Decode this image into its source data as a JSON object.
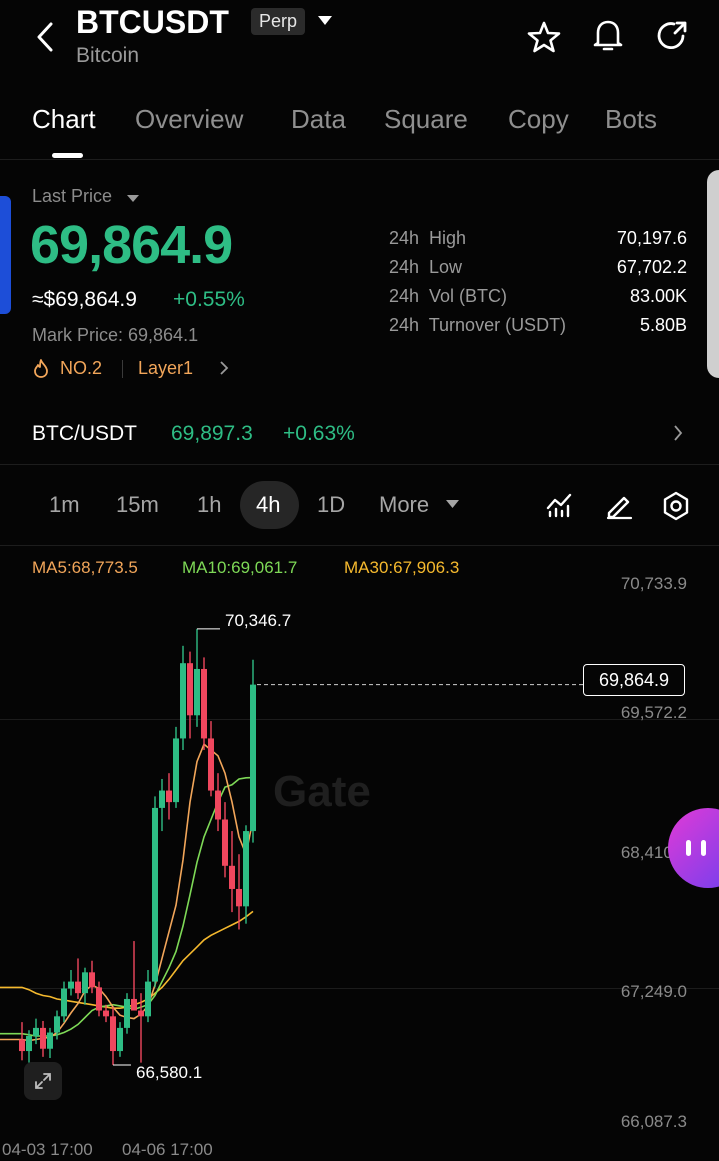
{
  "header": {
    "symbol": "BTCUSDT",
    "badge": "Perp",
    "subtitle": "Bitcoin",
    "icons": [
      "back-icon",
      "star-icon",
      "bell-icon",
      "share-icon"
    ]
  },
  "tabs": [
    "Chart",
    "Overview",
    "Data",
    "Square",
    "Copy",
    "Bots"
  ],
  "active_tab": "Chart",
  "price": {
    "label": "Last Price",
    "last": "69,864.9",
    "usd": "≈$69,864.9",
    "change": "+0.55%",
    "mark": "Mark Price: 69,864.1",
    "rank": "NO.2",
    "tag": "Layer1"
  },
  "stats": [
    {
      "label": "24h  High",
      "value": "70,197.6"
    },
    {
      "label": "24h  Low",
      "value": "67,702.2"
    },
    {
      "label": "24h  Vol (BTC)",
      "value": "83.00K"
    },
    {
      "label": "24h  Turnover (USDT)",
      "value": "5.80B"
    }
  ],
  "spot": {
    "pair": "BTC/USDT",
    "price": "69,897.3",
    "change": "+0.63%"
  },
  "timeframes": [
    "1m",
    "15m",
    "1h",
    "4h",
    "1D"
  ],
  "active_timeframe": "4h",
  "more_label": "More",
  "ma": {
    "ma5": "MA5:68,773.5",
    "ma10": "MA10:69,061.7",
    "ma30": "MA30:67,906.3"
  },
  "colors": {
    "up": "#2ebd85",
    "down": "#f0475e",
    "ma5": "#f2a65a",
    "ma10": "#7ed957",
    "ma30": "#f5b92e"
  },
  "chart_data": {
    "type": "candlestick",
    "y_ticks": [
      "70,733.9",
      "69,572.2",
      "68,410.6",
      "67,249.0",
      "66,087.3"
    ],
    "x_ticks": [
      "04-03 17:00",
      "04-06 17:00"
    ],
    "high_label": "70,346.7",
    "low_label": "66,580.1",
    "current_label": "69,864.9",
    "candles": [
      {
        "o": 66800,
        "h": 66950,
        "l": 66620,
        "c": 66700
      },
      {
        "o": 66700,
        "h": 66880,
        "l": 66600,
        "c": 66830
      },
      {
        "o": 66830,
        "h": 66980,
        "l": 66760,
        "c": 66900
      },
      {
        "o": 66900,
        "h": 66960,
        "l": 66650,
        "c": 66720
      },
      {
        "o": 66720,
        "h": 66900,
        "l": 66640,
        "c": 66860
      },
      {
        "o": 66860,
        "h": 67050,
        "l": 66800,
        "c": 67000
      },
      {
        "o": 67000,
        "h": 67300,
        "l": 66950,
        "c": 67240
      },
      {
        "o": 67240,
        "h": 67400,
        "l": 67180,
        "c": 67300
      },
      {
        "o": 67300,
        "h": 67500,
        "l": 67150,
        "c": 67200
      },
      {
        "o": 67200,
        "h": 67420,
        "l": 67100,
        "c": 67380
      },
      {
        "o": 67380,
        "h": 67480,
        "l": 67200,
        "c": 67250
      },
      {
        "o": 67250,
        "h": 67300,
        "l": 67000,
        "c": 67050
      },
      {
        "o": 67050,
        "h": 67100,
        "l": 66950,
        "c": 67000
      },
      {
        "o": 67000,
        "h": 67080,
        "l": 66580,
        "c": 66700
      },
      {
        "o": 66700,
        "h": 66950,
        "l": 66650,
        "c": 66900
      },
      {
        "o": 66900,
        "h": 67200,
        "l": 66850,
        "c": 67150
      },
      {
        "o": 67150,
        "h": 67650,
        "l": 67100,
        "c": 67050
      },
      {
        "o": 67050,
        "h": 67200,
        "l": 66600,
        "c": 67000
      },
      {
        "o": 67000,
        "h": 67400,
        "l": 66950,
        "c": 67300
      },
      {
        "o": 67300,
        "h": 68900,
        "l": 67250,
        "c": 68800
      },
      {
        "o": 68800,
        "h": 69050,
        "l": 68600,
        "c": 68950
      },
      {
        "o": 68950,
        "h": 69100,
        "l": 68700,
        "c": 68850
      },
      {
        "o": 68850,
        "h": 69500,
        "l": 68800,
        "c": 69400
      },
      {
        "o": 69400,
        "h": 70200,
        "l": 69300,
        "c": 70050
      },
      {
        "o": 70050,
        "h": 70150,
        "l": 69400,
        "c": 69600
      },
      {
        "o": 69600,
        "h": 70346.7,
        "l": 69500,
        "c": 70000
      },
      {
        "o": 70000,
        "h": 70100,
        "l": 69300,
        "c": 69400
      },
      {
        "o": 69400,
        "h": 69550,
        "l": 68900,
        "c": 68950
      },
      {
        "o": 68950,
        "h": 69100,
        "l": 68600,
        "c": 68700
      },
      {
        "o": 68700,
        "h": 68850,
        "l": 68200,
        "c": 68300
      },
      {
        "o": 68300,
        "h": 68600,
        "l": 67900,
        "c": 68100
      },
      {
        "o": 68100,
        "h": 68400,
        "l": 67750,
        "c": 67950
      },
      {
        "o": 67950,
        "h": 68650,
        "l": 67800,
        "c": 68600
      },
      {
        "o": 68600,
        "h": 70080,
        "l": 68500,
        "c": 69864.9
      }
    ],
    "ma5_line": [
      66800,
      66790,
      66800,
      66810,
      66820,
      66860,
      66940,
      67030,
      67110,
      67220,
      67270,
      67240,
      67170,
      67080,
      67010,
      66990,
      66980,
      67020,
      67090,
      67270,
      67500,
      67730,
      67960,
      68350,
      68850,
      69200,
      69350,
      69300,
      69250,
      69100,
      68850,
      68550,
      68400,
      68700
    ],
    "ma10_line": [
      66850,
      66840,
      66830,
      66830,
      66830,
      66840,
      66860,
      66890,
      66930,
      66990,
      67050,
      67080,
      67090,
      67100,
      67090,
      67080,
      67060,
      67080,
      67100,
      67180,
      67300,
      67420,
      67560,
      67780,
      68050,
      68330,
      68550,
      68700,
      68850,
      68980,
      69000,
      69050,
      69060,
      69062
    ],
    "ma30_line": [
      67250,
      67230,
      67200,
      67180,
      67170,
      67150,
      67140,
      67130,
      67120,
      67110,
      67100,
      67090,
      67080,
      67070,
      67070,
      67080,
      67100,
      67120,
      67150,
      67200,
      67250,
      67320,
      67400,
      67480,
      67540,
      67600,
      67660,
      67700,
      67730,
      67760,
      67790,
      67820,
      67860,
      67906
    ]
  },
  "expand_icon": "expand-icon"
}
